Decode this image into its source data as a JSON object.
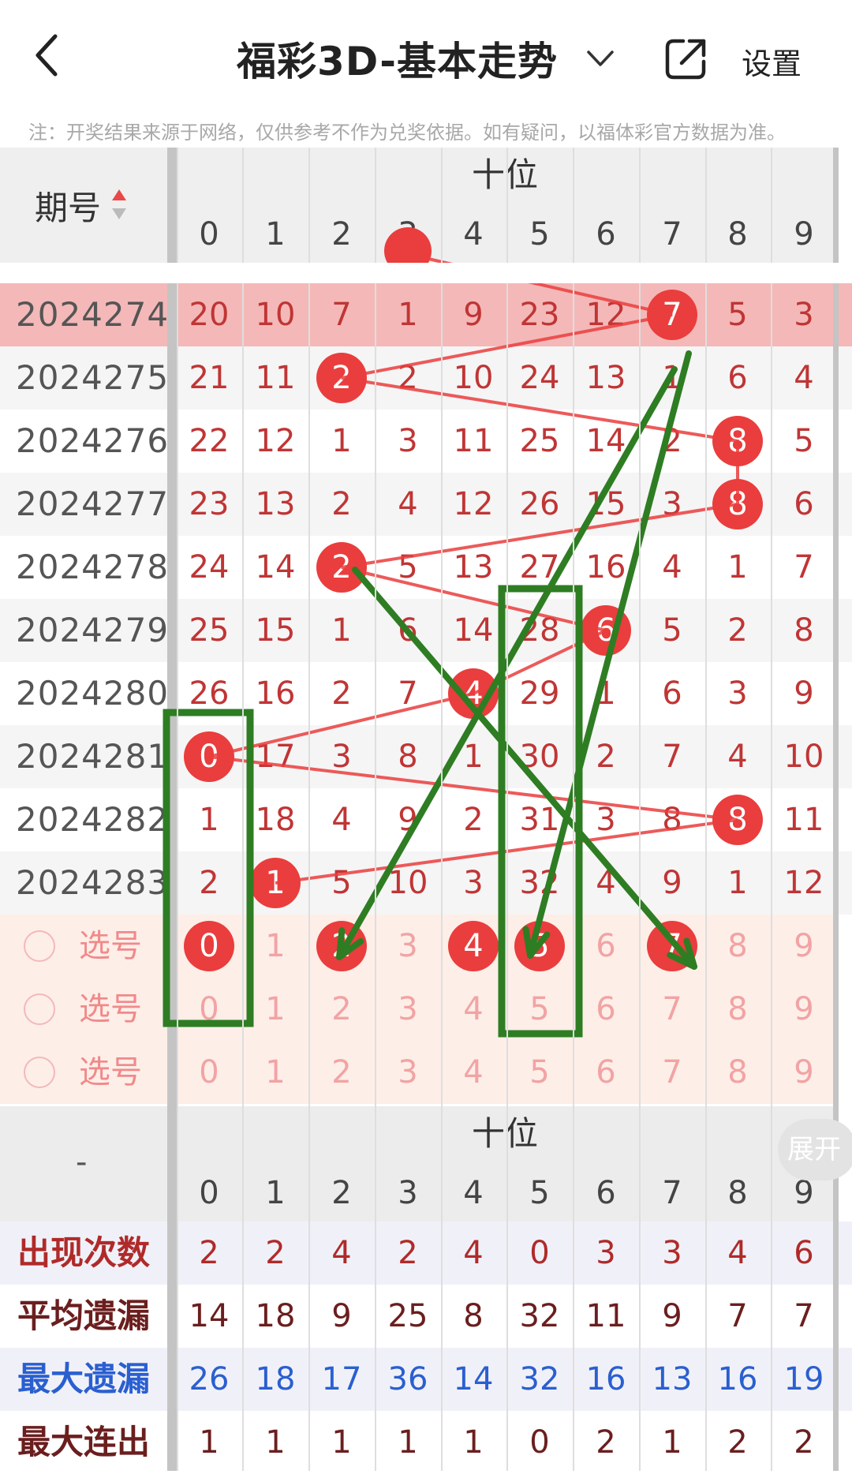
{
  "header": {
    "title": "福彩3D-基本走势",
    "settings_label": "设置",
    "note": "注：开奖结果来源于网络，仅供参考不作为兑奖依据。如有疑问，以福体彩官方数据为准。"
  },
  "table": {
    "period_header": "期号",
    "section_label": "十位",
    "digits": [
      "0",
      "1",
      "2",
      "3",
      "4",
      "5",
      "6",
      "7",
      "8",
      "9"
    ],
    "rows": [
      {
        "period": "2024274",
        "cells": [
          "20",
          "10",
          "7",
          "1",
          "9",
          "23",
          "12",
          "7",
          "5",
          "3"
        ],
        "hit": 7
      },
      {
        "period": "2024275",
        "cells": [
          "21",
          "11",
          "2",
          "2",
          "10",
          "24",
          "13",
          "1",
          "6",
          "4"
        ],
        "hit": 2
      },
      {
        "period": "2024276",
        "cells": [
          "22",
          "12",
          "1",
          "3",
          "11",
          "25",
          "14",
          "2",
          "8",
          "5"
        ],
        "hit": 8
      },
      {
        "period": "2024277",
        "cells": [
          "23",
          "13",
          "2",
          "4",
          "12",
          "26",
          "15",
          "3",
          "8",
          "6"
        ],
        "hit": 8
      },
      {
        "period": "2024278",
        "cells": [
          "24",
          "14",
          "2",
          "5",
          "13",
          "27",
          "16",
          "4",
          "1",
          "7"
        ],
        "hit": 2
      },
      {
        "period": "2024279",
        "cells": [
          "25",
          "15",
          "1",
          "6",
          "14",
          "28",
          "6",
          "5",
          "2",
          "8"
        ],
        "hit": 6
      },
      {
        "period": "2024280",
        "cells": [
          "26",
          "16",
          "2",
          "7",
          "4",
          "29",
          "1",
          "6",
          "3",
          "9"
        ],
        "hit": 4
      },
      {
        "period": "2024281",
        "cells": [
          "0",
          "17",
          "3",
          "8",
          "1",
          "30",
          "2",
          "7",
          "4",
          "10"
        ],
        "hit": 0
      },
      {
        "period": "2024282",
        "cells": [
          "1",
          "18",
          "4",
          "9",
          "2",
          "31",
          "3",
          "8",
          "8",
          "11"
        ],
        "hit": 8
      },
      {
        "period": "2024283",
        "cells": [
          "2",
          "1",
          "5",
          "10",
          "3",
          "32",
          "4",
          "9",
          "1",
          "12"
        ],
        "hit": 1
      }
    ]
  },
  "selectors": [
    {
      "label": "选号",
      "digits": [
        "0",
        "1",
        "2",
        "3",
        "4",
        "5",
        "6",
        "7",
        "8",
        "9"
      ],
      "selected": [
        0,
        2,
        4,
        5,
        7
      ]
    },
    {
      "label": "选号",
      "digits": [
        "0",
        "1",
        "2",
        "3",
        "4",
        "5",
        "6",
        "7",
        "8",
        "9"
      ],
      "selected": []
    },
    {
      "label": "选号",
      "digits": [
        "0",
        "1",
        "2",
        "3",
        "4",
        "5",
        "6",
        "7",
        "8",
        "9"
      ],
      "selected": []
    }
  ],
  "stats": {
    "corner_label": "-",
    "section_label": "十位",
    "expand_label": "展开",
    "digits": [
      "0",
      "1",
      "2",
      "3",
      "4",
      "5",
      "6",
      "7",
      "8",
      "9"
    ],
    "rows": [
      {
        "label": "出现次数",
        "values": [
          "2",
          "2",
          "4",
          "2",
          "4",
          "0",
          "3",
          "3",
          "4",
          "6"
        ],
        "color": "#b02a2a"
      },
      {
        "label": "平均遗漏",
        "values": [
          "14",
          "18",
          "9",
          "25",
          "8",
          "32",
          "11",
          "9",
          "7",
          "7"
        ],
        "color": "#6b1e1e"
      },
      {
        "label": "最大遗漏",
        "values": [
          "26",
          "18",
          "17",
          "36",
          "14",
          "32",
          "16",
          "13",
          "16",
          "19"
        ],
        "color": "#2a5fd0"
      },
      {
        "label": "最大连出",
        "values": [
          "1",
          "1",
          "1",
          "1",
          "1",
          "0",
          "2",
          "1",
          "2",
          "2"
        ],
        "color": "#6b1e1e"
      }
    ]
  },
  "colors": {
    "accent": "#ea3d3d",
    "annotation_green": "#2e7d23",
    "highlight_row": "#f4b8b8"
  }
}
